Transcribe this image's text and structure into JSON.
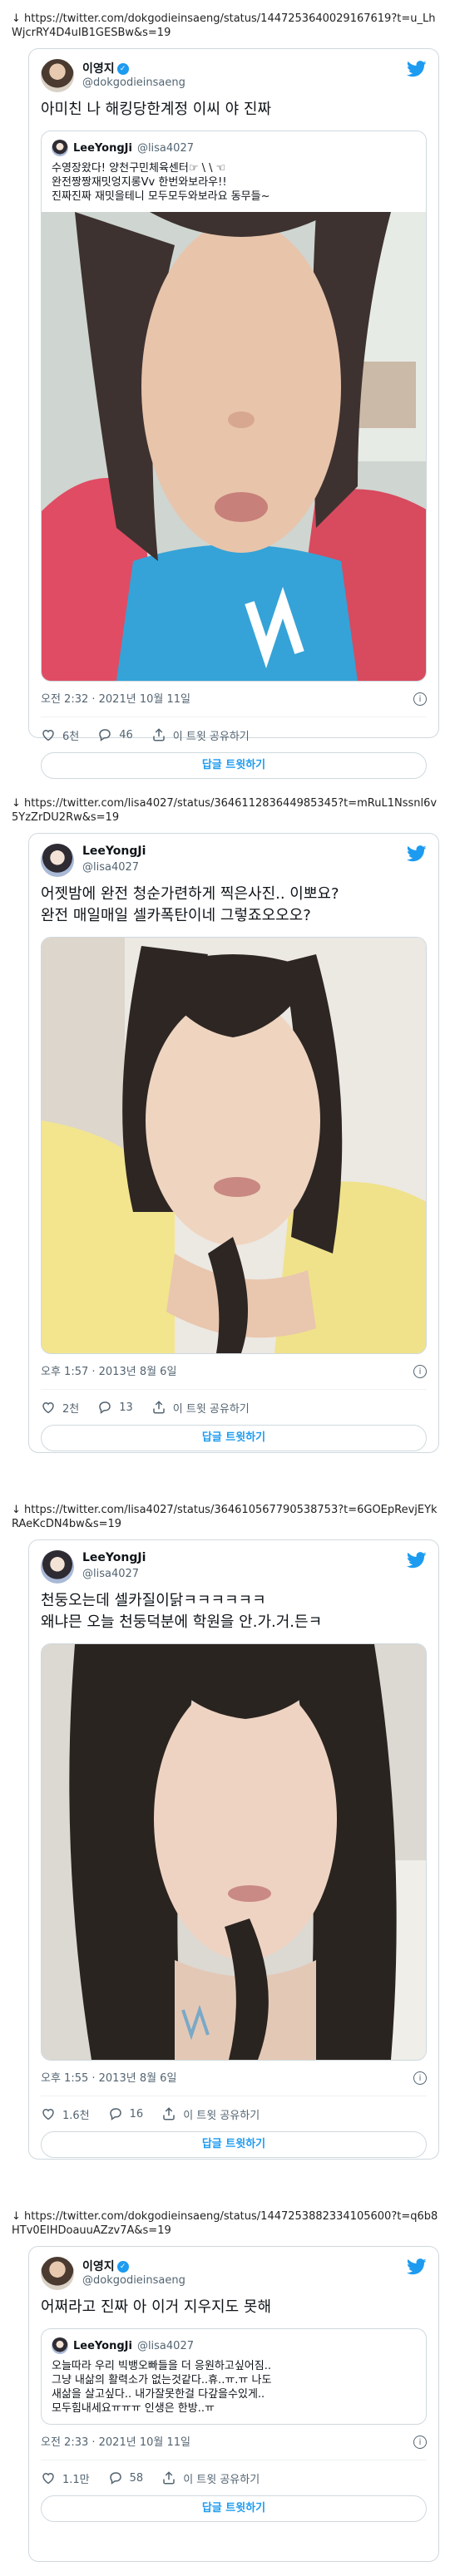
{
  "posts": [
    {
      "url": "↓ https://twitter.com/dokgodieinsaeng/status/1447253640029167619?t=u_LhWjcrRY4D4uIB1GESBw&s=19",
      "author_name": "이영지",
      "author_handle": "@dokgodieinsaeng",
      "text": "아미친 나 해킹당한계정 이씨 야 진짜",
      "quote": {
        "name": "LeeYongJi",
        "handle": "@lisa4027",
        "text": "수영장왔다! 양천구민체육센터☞ \\ \\ ☜\n완전짱짱재밋엉지롱Vv 한번와보라우!!\n진짜진짜 재밋을테니 모두모두와보라요 동무들~"
      },
      "timestamp": "오전 2:32 · 2021년 10월 11일",
      "likes": "6천",
      "replies": "46",
      "share_label": "이 트윗 공유하기",
      "reply_button": "답글 트윗하기"
    },
    {
      "url": "↓ https://twitter.com/lisa4027/status/364611283644985345?t=mRuL1Nssnl6v5YzZrDU2Rw&s=19",
      "author_name": "LeeYongJi",
      "author_handle": "@lisa4027",
      "text": "어젯밤에 완전 청순가련하게 찍은사진.. 이뽀요?\n완전 매일매일 셀카폭탄이네 그렇죠오오오?",
      "timestamp": "오후 1:57 · 2013년 8월 6일",
      "likes": "2천",
      "replies": "13",
      "share_label": "이 트윗 공유하기",
      "reply_button": "답글 트윗하기"
    },
    {
      "url": "↓ https://twitter.com/lisa4027/status/364610567790538753?t=6GOEpRevjEYkRAeKcDN4bw&s=19",
      "author_name": "LeeYongJi",
      "author_handle": "@lisa4027",
      "text": "천둥오는데 셀카질이닭ㅋㅋㅋㅋㅋㅋ\n왜냐믄 오늘 천둥덕분에 학원을 안.가.거.든ㅋ",
      "timestamp": "오후 1:55 · 2013년 8월 6일",
      "likes": "1.6천",
      "replies": "16",
      "share_label": "이 트윗 공유하기",
      "reply_button": "답글 트윗하기"
    },
    {
      "url": "↓ https://twitter.com/dokgodieinsaeng/status/1447253882334105600?t=q6b8HTv0EIHDoauuAZzv7A&s=19",
      "author_name": "이영지",
      "author_handle": "@dokgodieinsaeng",
      "text": "어쩌라고 진짜 아 이거 지우지도 못해",
      "quote": {
        "name": "LeeYongJi",
        "handle": "@lisa4027",
        "text": "오늘따라 우리 빅뱅오빠들을 더 응원하고싶어짐..\n그냥 내삶의 활력소가 없는것같다..휴..ㅠ.ㅠ 나도\n새삶을 살고싶다.. 내가잘못한걸 다갚을수있게..\n모두힘내세요ㅠㅠㅠ 인생은 한방..ㅠ"
      },
      "timestamp": "오전 2:33 · 2021년 10월 11일",
      "likes": "1.1만",
      "replies": "58",
      "share_label": "이 트윗 공유하기",
      "reply_button": "답글 트윗하기"
    }
  ],
  "icons": {
    "bird": "twitter-bird-icon",
    "heart": "heart-icon",
    "reply": "reply-icon",
    "share": "share-icon",
    "info": "info-icon"
  },
  "colors": {
    "accent": "#1d9bf0",
    "border": "#cfd9de",
    "muted": "#536471"
  }
}
